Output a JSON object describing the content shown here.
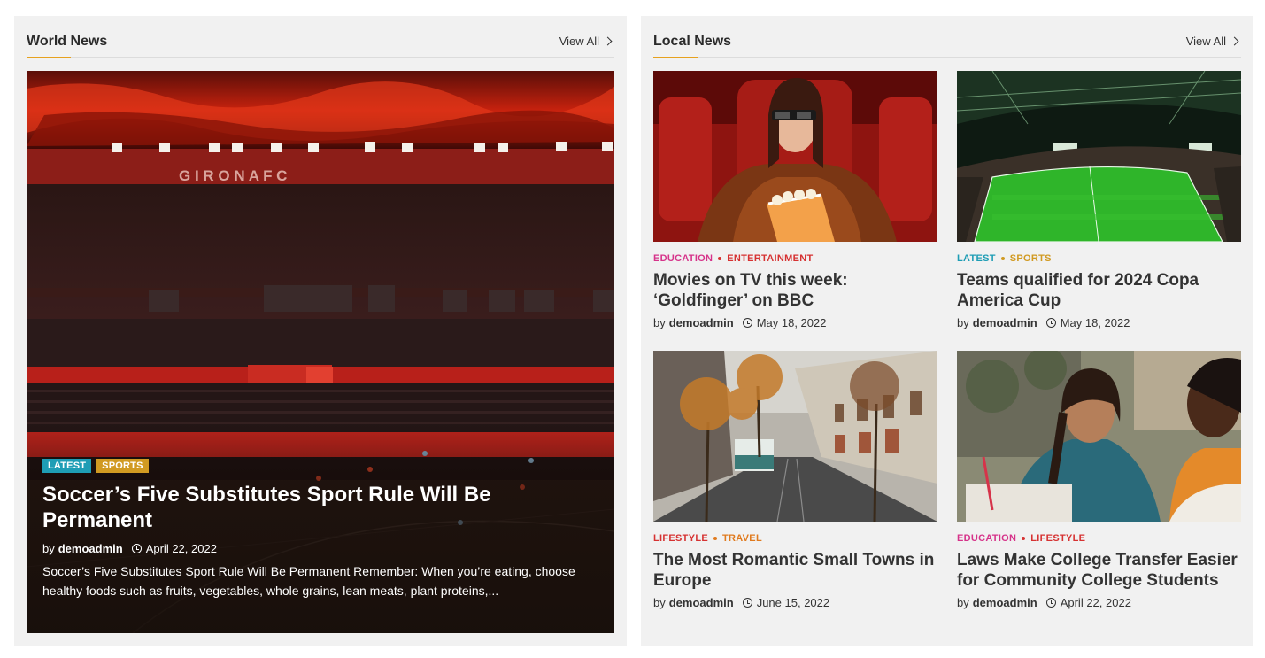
{
  "world": {
    "title": "World News",
    "view_all": "View All",
    "featured": {
      "tags": [
        {
          "label": "LATEST",
          "color": "#1e9db5"
        },
        {
          "label": "SPORTS",
          "color": "#d19a22"
        }
      ],
      "title": "Soccer’s Five Substitutes Sport Rule Will Be Permanent",
      "by": "by",
      "author": "demoadmin",
      "date": "April 22, 2022",
      "excerpt": "Soccer’s Five Substitutes Sport Rule Will Be Permanent Remember: When you’re eating, choose healthy foods such as fruits, vegetables, whole grains, lean meats, plant proteins,...",
      "stadium_text": "G  I  R  O  N  A     F  C"
    }
  },
  "local": {
    "title": "Local News",
    "view_all": "View All",
    "articles": [
      {
        "cats": [
          {
            "label": "EDUCATION",
            "color": "#d6338a"
          },
          {
            "label": "ENTERTAINMENT",
            "color": "#d63232"
          }
        ],
        "dot_color": "#d63232",
        "title": "Movies on TV this week: ‘Goldfinger’ on BBC",
        "by": "by",
        "author": "demoadmin",
        "date": "May 18, 2022"
      },
      {
        "cats": [
          {
            "label": "LATEST",
            "color": "#1e9db5"
          },
          {
            "label": "SPORTS",
            "color": "#d19a22"
          }
        ],
        "dot_color": "#d19a22",
        "title": "Teams qualified for 2024 Copa America Cup",
        "by": "by",
        "author": "demoadmin",
        "date": "May 18, 2022"
      },
      {
        "cats": [
          {
            "label": "LIFESTYLE",
            "color": "#d63232"
          },
          {
            "label": "TRAVEL",
            "color": "#e07a1e"
          }
        ],
        "dot_color": "#e07a1e",
        "title": "The Most Romantic Small Towns in Europe",
        "by": "by",
        "author": "demoadmin",
        "date": "June 15, 2022"
      },
      {
        "cats": [
          {
            "label": "EDUCATION",
            "color": "#d6338a"
          },
          {
            "label": "LIFESTYLE",
            "color": "#d63232"
          }
        ],
        "dot_color": "#d63232",
        "title": "Laws Make College Transfer Easier for Community College Students",
        "by": "by",
        "author": "demoadmin",
        "date": "April 22, 2022"
      }
    ]
  }
}
